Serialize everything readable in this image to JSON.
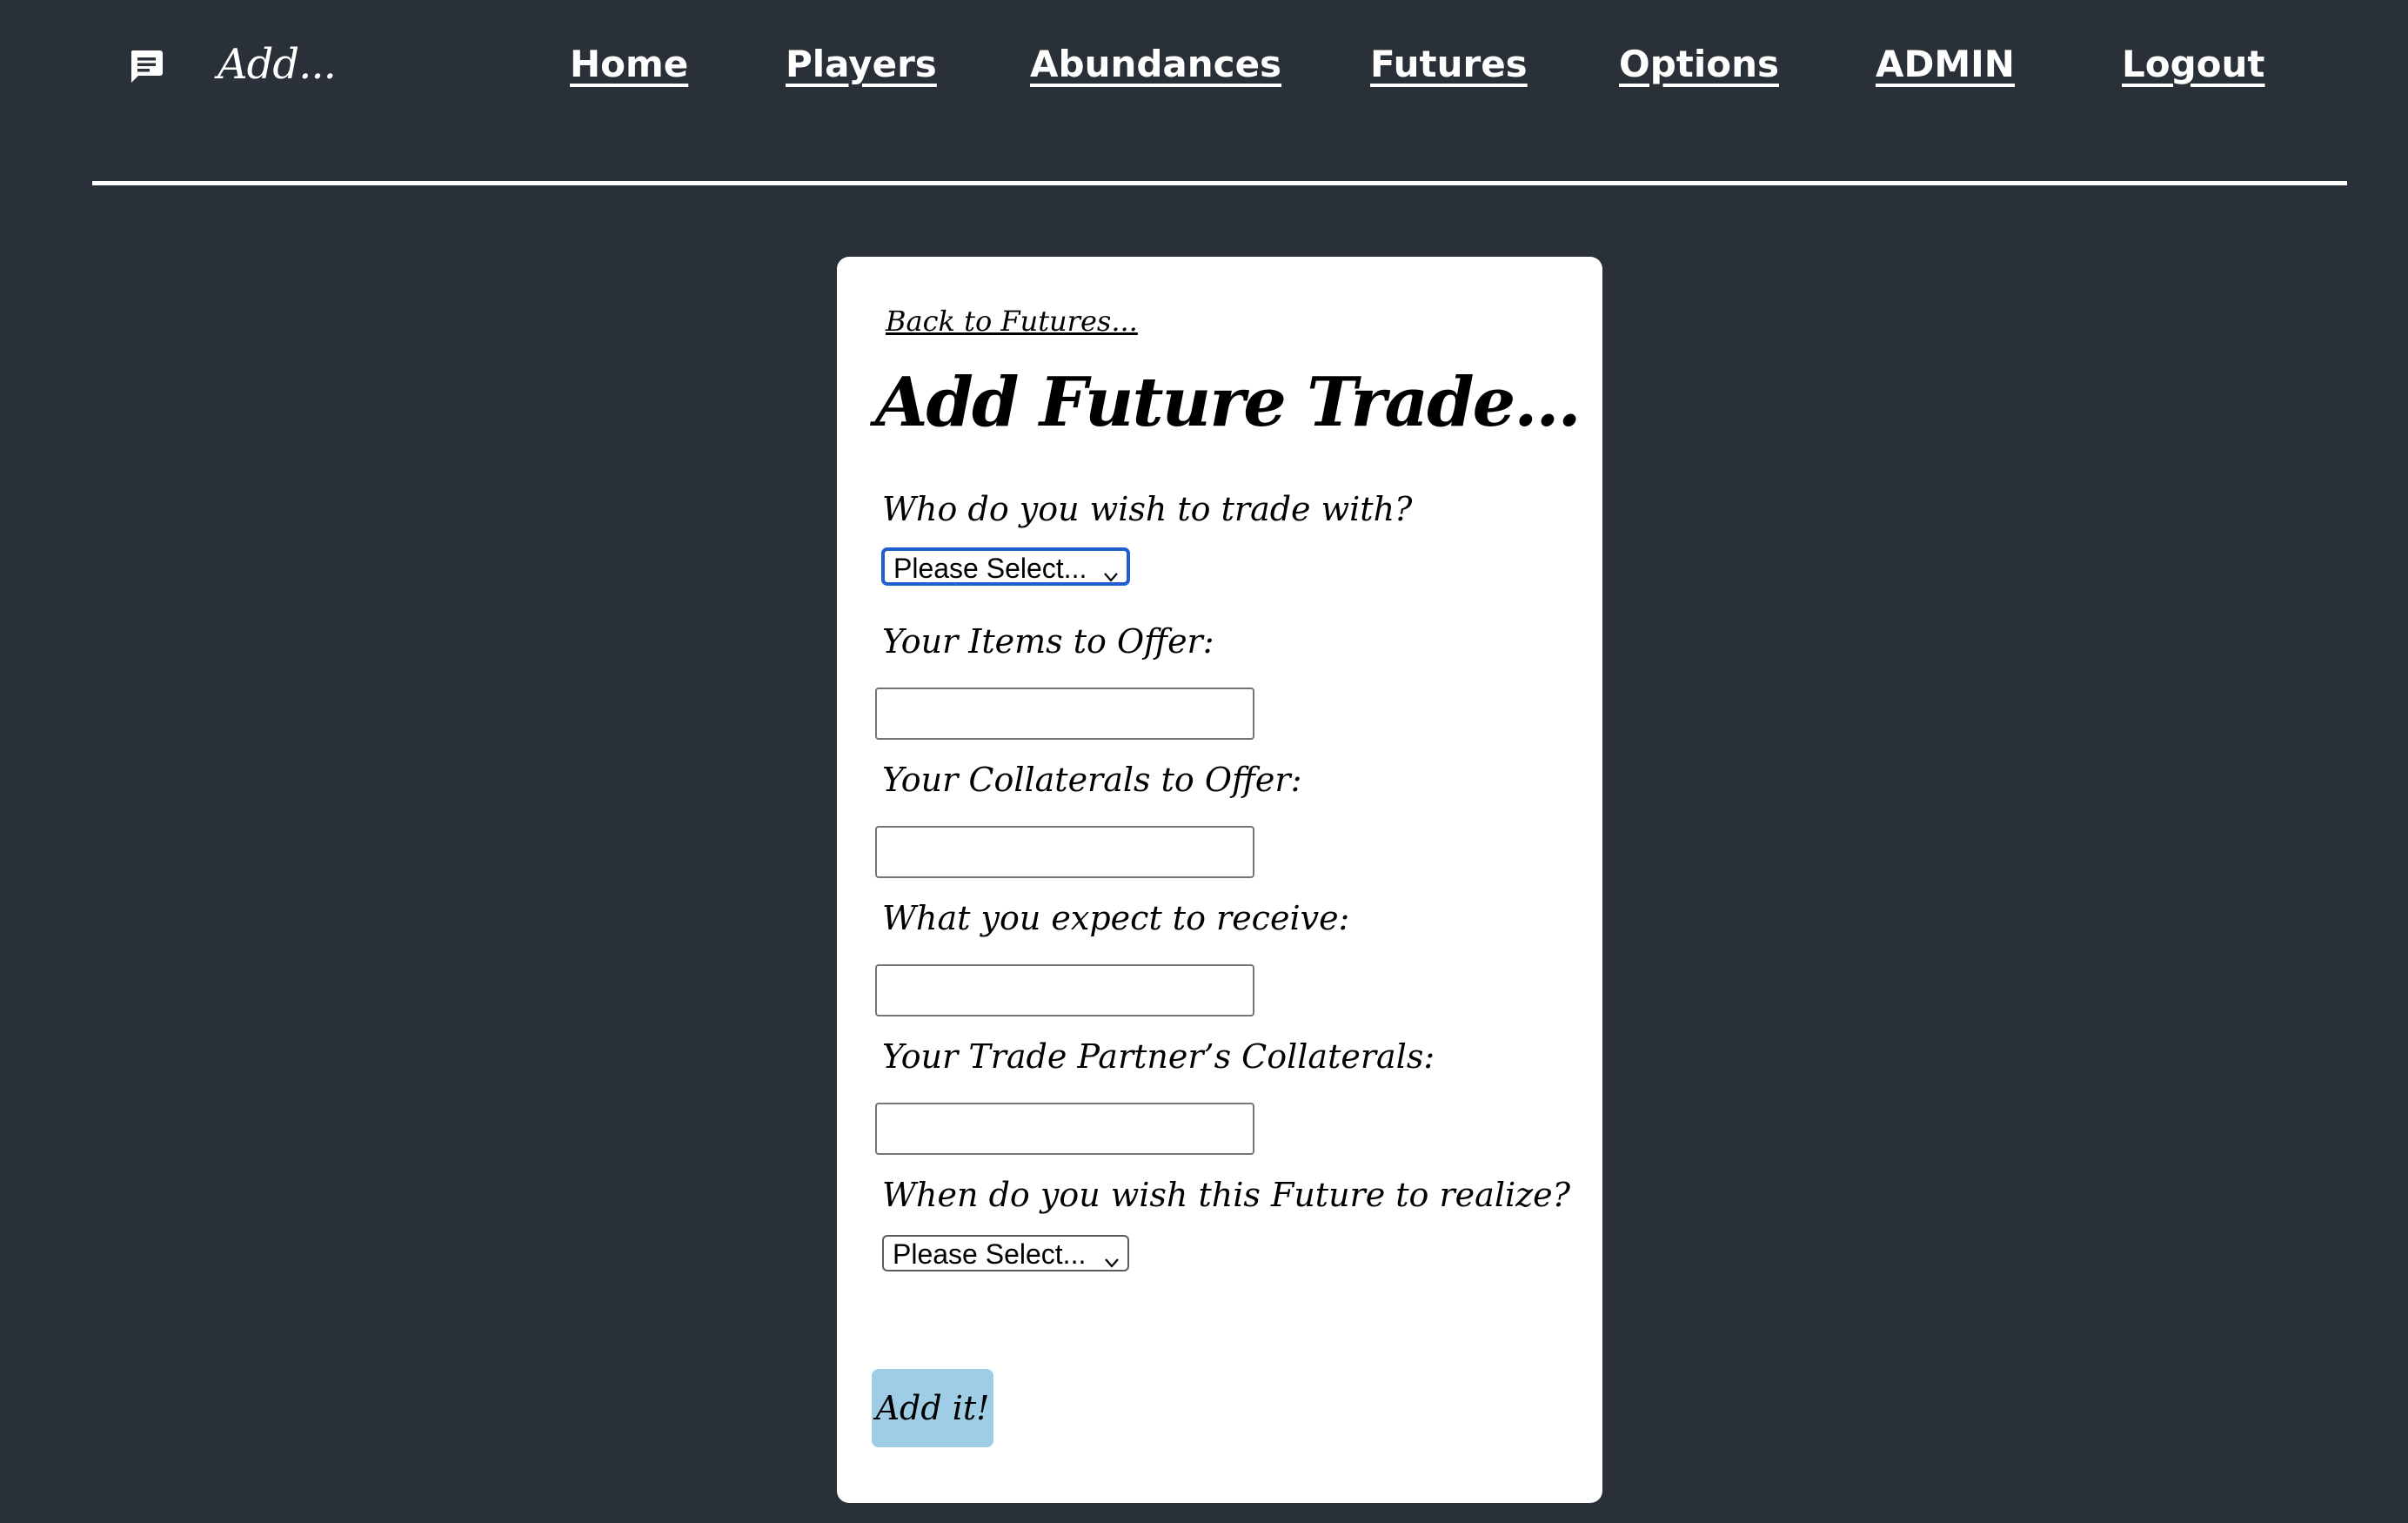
{
  "header": {
    "icon": "chat-icon",
    "page_tag": "Add...",
    "nav": [
      {
        "label": "Home"
      },
      {
        "label": "Players"
      },
      {
        "label": "Abundances"
      },
      {
        "label": "Futures"
      },
      {
        "label": "Options"
      },
      {
        "label": "ADMIN"
      },
      {
        "label": "Logout"
      }
    ]
  },
  "card": {
    "back_link": "Back to Futures...",
    "title": "Add Future Trade...",
    "fields": {
      "partner": {
        "label": "Who do you wish to trade with?",
        "selected": "Please Select..."
      },
      "items_offer": {
        "label": "Your Items to Offer:",
        "value": ""
      },
      "collaterals_offer": {
        "label": "Your Collaterals to Offer:",
        "value": ""
      },
      "expect_receive": {
        "label": "What you expect to receive:",
        "value": ""
      },
      "partner_collaterals": {
        "label": "Your Trade Partner’s Collaterals:",
        "value": ""
      },
      "realize_when": {
        "label": "When do you wish this Future to realize?",
        "selected": "Please Select..."
      }
    },
    "submit_label": "Add it!"
  },
  "colors": {
    "background": "#2a3037",
    "card": "#ffffff",
    "button": "#9fcde6",
    "focus_ring": "#1f5fd0"
  }
}
